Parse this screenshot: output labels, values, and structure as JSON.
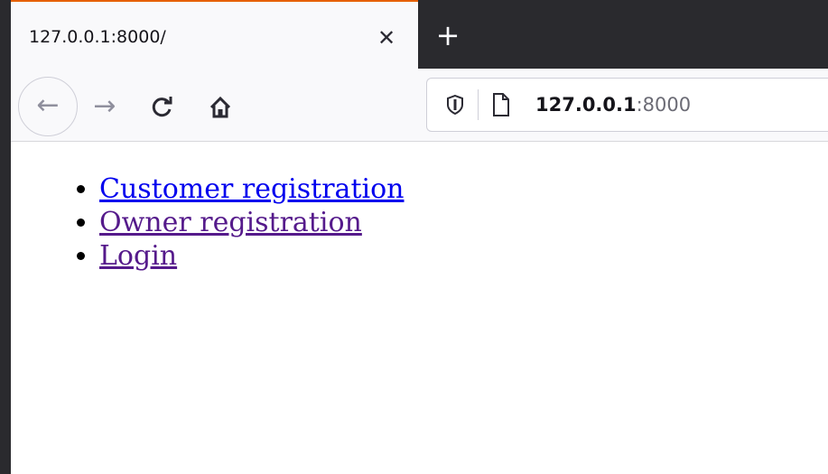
{
  "browser": {
    "tab": {
      "title": "127.0.0.1:8000/",
      "close_icon": "close-icon"
    },
    "new_tab_icon": "plus-icon",
    "toolbar": {
      "back_icon": "arrow-left-icon",
      "forward_icon": "arrow-right-icon",
      "reload_icon": "reload-icon",
      "home_icon": "home-icon"
    },
    "urlbar": {
      "host": "127.0.0.1",
      "port": ":8000",
      "tracking_icon": "shield-icon",
      "page_icon": "page-icon"
    },
    "colors": {
      "tab_accent": "#e66000",
      "link_unvisited": "#0000ee",
      "link_visited": "#551a8b"
    }
  },
  "page": {
    "links": [
      {
        "label": "Customer registration",
        "visited": false
      },
      {
        "label": "Owner registration",
        "visited": true
      },
      {
        "label": "Login",
        "visited": true
      }
    ]
  }
}
